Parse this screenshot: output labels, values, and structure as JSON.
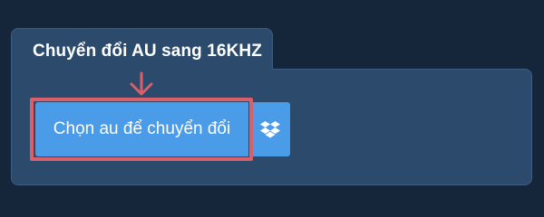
{
  "converter": {
    "title": "Chuyển đổi AU sang 16KHZ",
    "choose_label": "Chọn au để chuyển đổi",
    "cloud_icon": "dropbox-icon"
  },
  "colors": {
    "background": "#16263a",
    "panel": "#2c4a6c",
    "button": "#4a9be8",
    "highlight": "#d9606a"
  }
}
